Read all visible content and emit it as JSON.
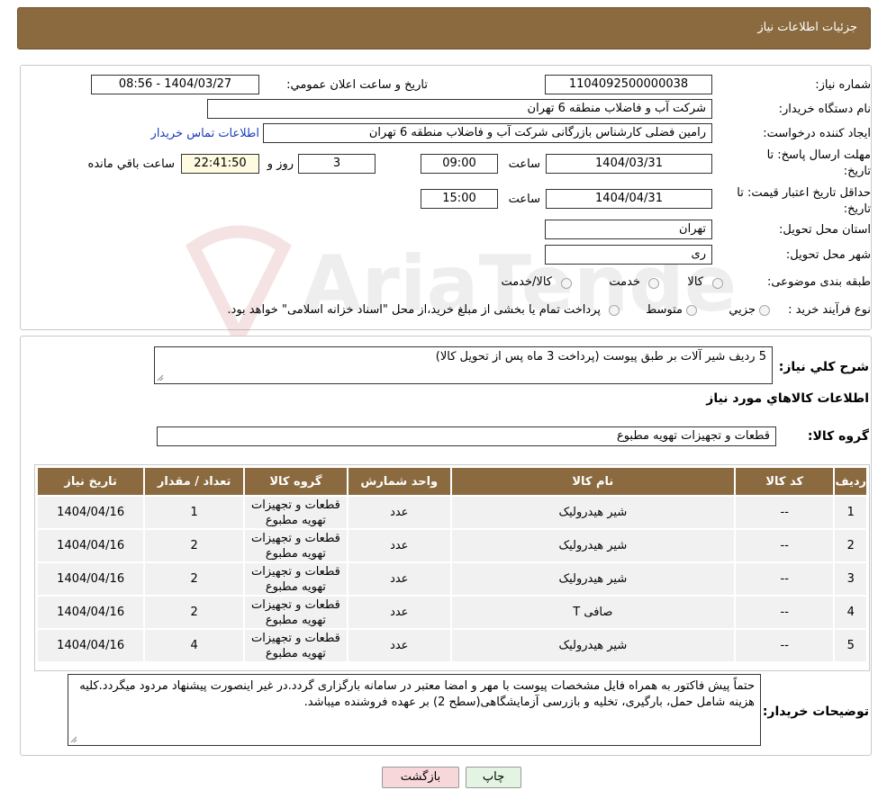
{
  "header": {
    "title": "جزئیات اطلاعات نیاز"
  },
  "form": {
    "need_number_label": "شماره نیاز:",
    "need_number": "1104092500000038",
    "announce_label": "تاریخ و ساعت اعلان عمومي:",
    "announce_value": "1404/03/27 - 08:56",
    "buyer_org_label": "نام دستگاه خريدار:",
    "buyer_org": "شرکت آب و فاضلاب منطقه 6 تهران",
    "requester_label": "ایجاد کننده درخواست:",
    "requester": "رامین  فضلی کارشناس بازرگانی شرکت آب و فاضلاب منطقه 6 تهران",
    "contact_link": "اطلاعات تماس خريدار",
    "reply_deadline_label_1": "مهلت ارسال پاسخ: تا",
    "reply_deadline_label_2": "تاریخ:",
    "reply_date": "1404/03/31",
    "time_label": "ساعت",
    "reply_time": "09:00",
    "days_value": "3",
    "days_label": "روز و",
    "remaining_time": "22:41:50",
    "remaining_label": "ساعت باقي مانده",
    "validity_label_1": "حداقل تاریخ اعتبار قیمت: تا",
    "validity_label_2": "تاریخ:",
    "validity_date": "1404/04/31",
    "validity_time": "15:00",
    "province_label": "استان محل تحویل:",
    "province": "تهران",
    "city_label": "شهر محل تحویل:",
    "city": "ری",
    "category_label": "طبقه بندی موضوعی:",
    "category_options": [
      "کالا",
      "خدمت",
      "کالا/خدمت"
    ],
    "process_label": "نوع فرآیند خرید :",
    "process_options": [
      "جزیي",
      "متوسط"
    ],
    "process_note": "پرداخت تمام یا بخشی از مبلغ خرید،از محل \"اسناد خزانه اسلامی\" خواهد بود."
  },
  "watermark": {
    "text": "AriaTender.neT"
  },
  "summary": {
    "label": "شرح کلي نیاز:",
    "value": "5 ردیف شیر آلات بر طبق پیوست (پرداخت 3 ماه پس از تحویل کالا)"
  },
  "goods": {
    "section_title": "اطلاعات کالاهاي مورد نیاز",
    "group_label": "گروه کالا:",
    "group_value": "قطعات و تجهیزات تهویه مطبوع",
    "columns": [
      "ردیف",
      "کد کالا",
      "نام کالا",
      "واحد شمارش",
      "گروه کالا",
      "تعداد / مقدار",
      "تاریخ نیاز"
    ],
    "rows": [
      [
        "1",
        "--",
        "شیر هیدرولیک",
        "عدد",
        "قطعات و تجهیزات تهویه مطبوع",
        "1",
        "1404/04/16"
      ],
      [
        "2",
        "--",
        "شیر هیدرولیک",
        "عدد",
        "قطعات و تجهیزات تهویه مطبوع",
        "2",
        "1404/04/16"
      ],
      [
        "3",
        "--",
        "شیر هیدرولیک",
        "عدد",
        "قطعات و تجهیزات تهویه مطبوع",
        "2",
        "1404/04/16"
      ],
      [
        "4",
        "--",
        "صافی T",
        "عدد",
        "قطعات و تجهیزات تهویه مطبوع",
        "2",
        "1404/04/16"
      ],
      [
        "5",
        "--",
        "شیر هیدرولیک",
        "عدد",
        "قطعات و تجهیزات تهویه مطبوع",
        "4",
        "1404/04/16"
      ]
    ]
  },
  "buyer_notes": {
    "label": "توضیحات خریدار:",
    "value": "حتماً پیش فاکتور به همراه فایل مشخصات پیوست با مهر و امضا معتبر در سامانه بارگزاری گردد.در غیر اینصورت پیشنهاد مردود میگردد.کلیه هزینه شامل حمل، بارگیری، تخلیه و بازرسی آزمایشگاهی(سطح 2) بر عهده فروشنده میباشد."
  },
  "buttons": {
    "print": "چاپ",
    "back": "بازگشت"
  },
  "colors": {
    "header_bg": "#8a6a3e",
    "link": "#1a3bbf",
    "back_button_bg": "#f8d7da",
    "print_button_bg": "#e3f4e3"
  }
}
